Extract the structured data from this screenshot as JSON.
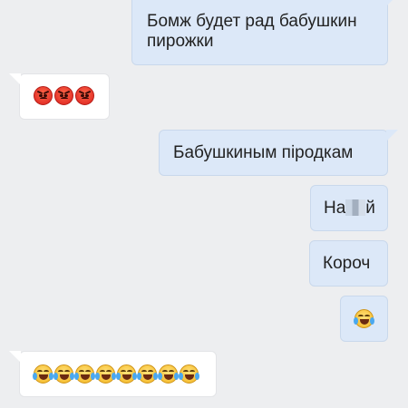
{
  "messages": [
    {
      "id": "m1",
      "side": "out",
      "text_line1": "Бомж будет рад бабушкин",
      "text_line2": "пирожки"
    },
    {
      "id": "m2",
      "side": "in",
      "emoji": [
        "angry-face",
        "angry-face",
        "angry-face"
      ]
    },
    {
      "id": "m3",
      "side": "out",
      "text": "Бабушкиным піродкам"
    },
    {
      "id": "m4",
      "side": "out",
      "text_before": "На",
      "text_after": "й",
      "redacted": true
    },
    {
      "id": "m5",
      "side": "out",
      "text": "Короч"
    },
    {
      "id": "m6",
      "side": "out",
      "emoji": [
        "face-with-tears-of-joy"
      ]
    },
    {
      "id": "m7",
      "side": "in",
      "emoji": [
        "face-with-tears-of-joy",
        "face-with-tears-of-joy",
        "face-with-tears-of-joy",
        "face-with-tears-of-joy",
        "face-with-tears-of-joy",
        "face-with-tears-of-joy",
        "face-with-tears-of-joy",
        "face-with-tears-of-joy"
      ]
    }
  ],
  "colors": {
    "background": "#edeef0",
    "outgoing_bubble": "#dce8f8",
    "incoming_bubble": "#ffffff",
    "text": "#222222"
  }
}
